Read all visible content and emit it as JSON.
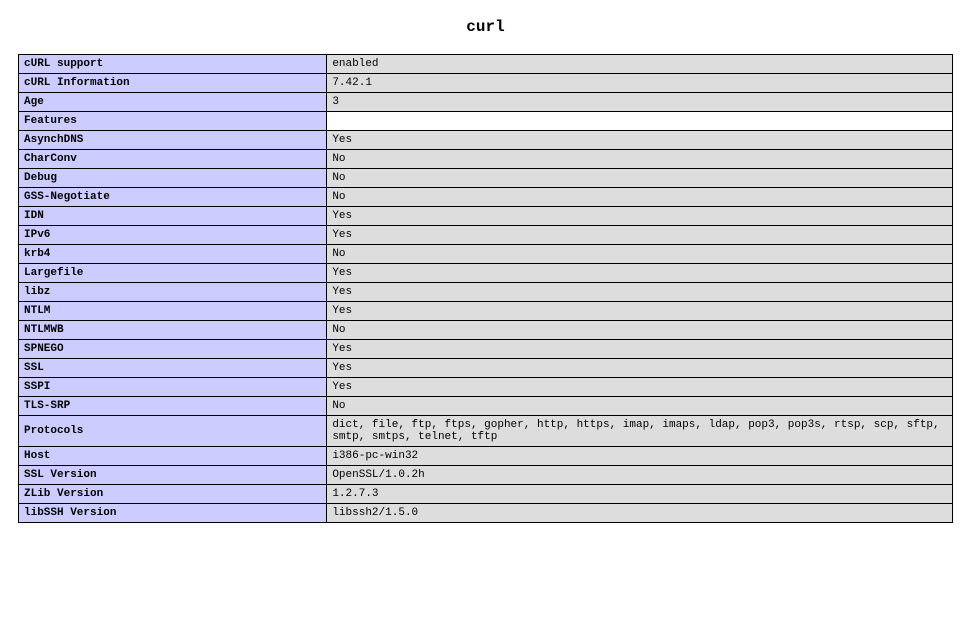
{
  "title": "curl",
  "rows": [
    {
      "label": "cURL support",
      "value": "enabled"
    },
    {
      "label": "cURL Information",
      "value": "7.42.1"
    },
    {
      "label": "Age",
      "value": "3"
    },
    {
      "label": "Features",
      "value": "",
      "empty": true
    },
    {
      "label": "AsynchDNS",
      "value": "Yes"
    },
    {
      "label": "CharConv",
      "value": "No"
    },
    {
      "label": "Debug",
      "value": "No"
    },
    {
      "label": "GSS-Negotiate",
      "value": "No"
    },
    {
      "label": "IDN",
      "value": "Yes"
    },
    {
      "label": "IPv6",
      "value": "Yes"
    },
    {
      "label": "krb4",
      "value": "No"
    },
    {
      "label": "Largefile",
      "value": "Yes"
    },
    {
      "label": "libz",
      "value": "Yes"
    },
    {
      "label": "NTLM",
      "value": "Yes"
    },
    {
      "label": "NTLMWB",
      "value": "No"
    },
    {
      "label": "SPNEGO",
      "value": "Yes"
    },
    {
      "label": "SSL",
      "value": "Yes"
    },
    {
      "label": "SSPI",
      "value": "Yes"
    },
    {
      "label": "TLS-SRP",
      "value": "No"
    },
    {
      "label": "Protocols",
      "value": "dict, file, ftp, ftps, gopher, http, https, imap, imaps, ldap, pop3, pop3s, rtsp, scp, sftp, smtp, smtps, telnet, tftp"
    },
    {
      "label": "Host",
      "value": "i386-pc-win32"
    },
    {
      "label": "SSL Version",
      "value": "OpenSSL/1.0.2h"
    },
    {
      "label": "ZLib Version",
      "value": "1.2.7.3"
    },
    {
      "label": "libSSH Version",
      "value": "libssh2/1.5.0"
    }
  ]
}
